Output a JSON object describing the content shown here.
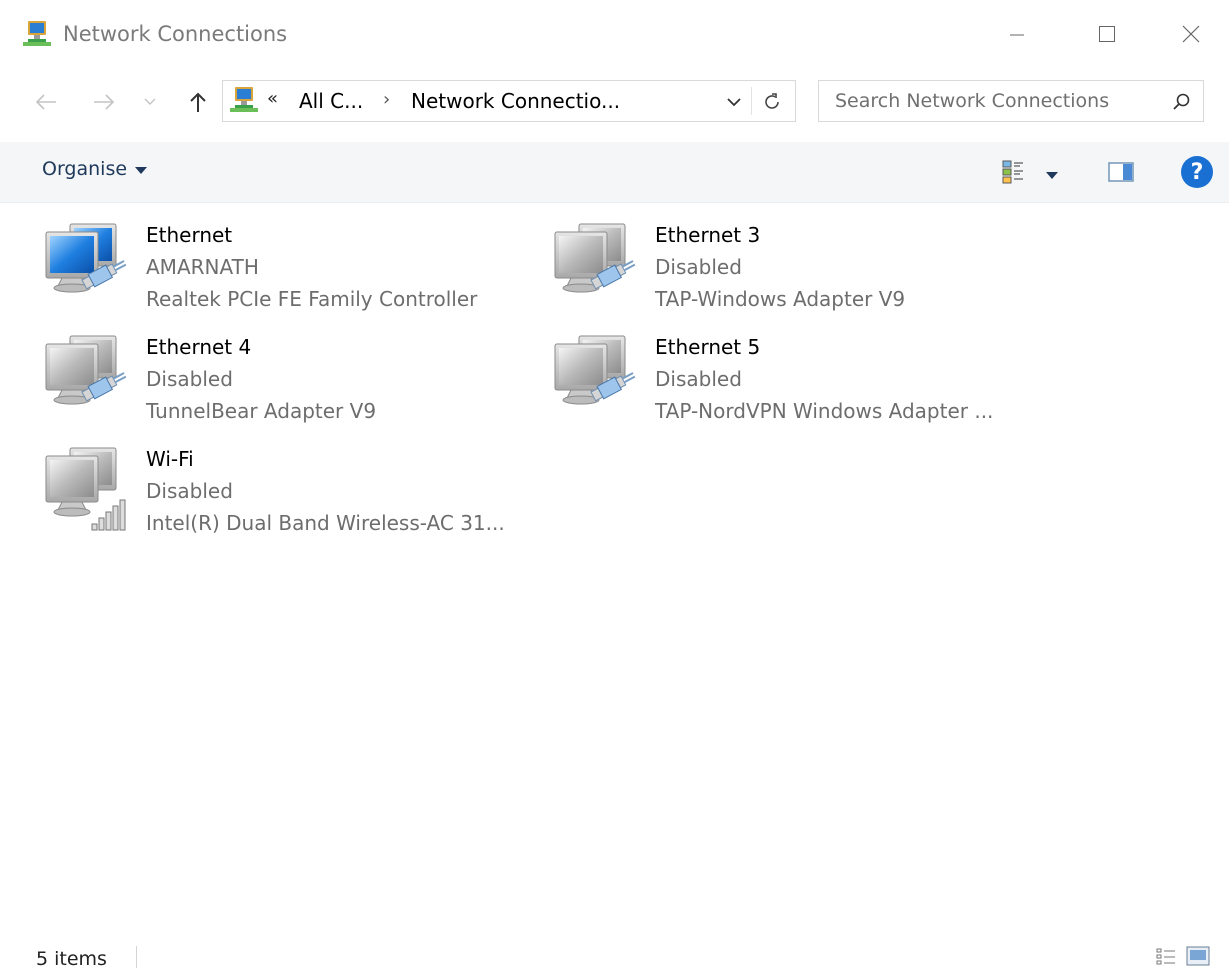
{
  "window": {
    "title": "Network Connections",
    "controls": [
      "minimize",
      "maximize",
      "close"
    ]
  },
  "address_bar": {
    "overflow_chevron": "«",
    "segments": [
      "All C...",
      "Network Connectio..."
    ],
    "separator": "›"
  },
  "search": {
    "placeholder": "Search Network Connections"
  },
  "command_bar": {
    "organise_label": "Organise"
  },
  "connections": [
    {
      "name": "Ethernet",
      "status": "AMARNATH",
      "device": "Realtek PCIe FE Family Controller",
      "type": "ethernet",
      "enabled": true
    },
    {
      "name": "Ethernet 3",
      "status": "Disabled",
      "device": "TAP-Windows Adapter V9",
      "type": "ethernet",
      "enabled": false
    },
    {
      "name": "Ethernet 4",
      "status": "Disabled",
      "device": "TunnelBear Adapter V9",
      "type": "ethernet",
      "enabled": false
    },
    {
      "name": "Ethernet 5",
      "status": "Disabled",
      "device": "TAP-NordVPN Windows Adapter ...",
      "type": "ethernet",
      "enabled": false
    },
    {
      "name": "Wi-Fi",
      "status": "Disabled",
      "device": "Intel(R) Dual Band Wireless-AC 31...",
      "type": "wifi",
      "enabled": false
    }
  ],
  "status_bar": {
    "item_count": "5 items"
  },
  "colors": {
    "accent": "#1a6fd2",
    "command_bar_bg": "#f5f6f7",
    "command_text": "#1e395b",
    "secondary_text": "#6d6d6d"
  }
}
